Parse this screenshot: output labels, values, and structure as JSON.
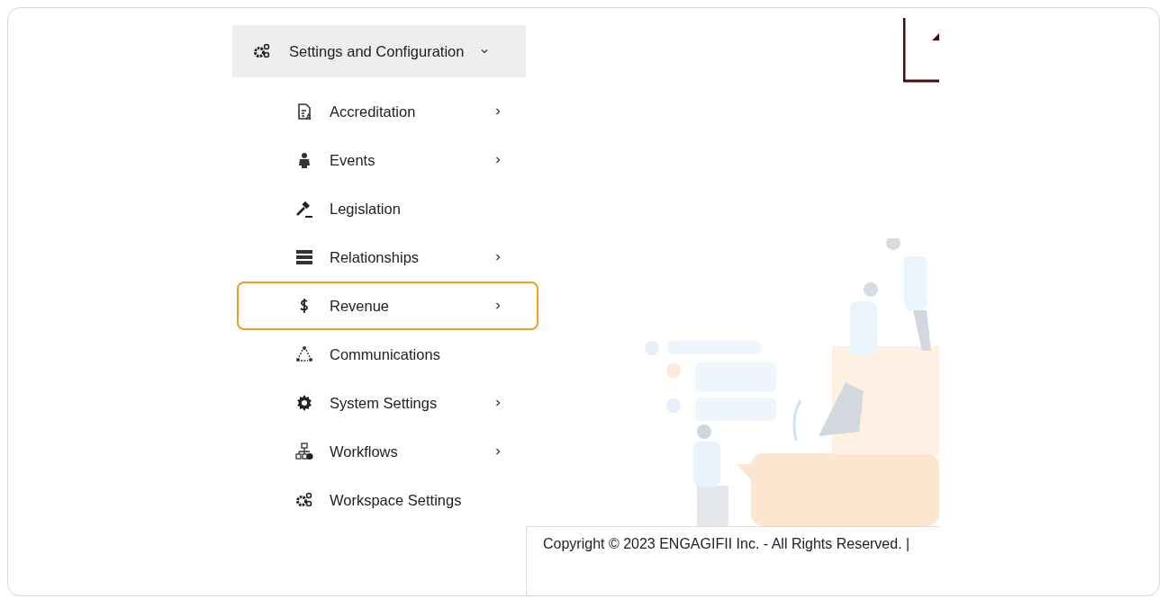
{
  "menu": {
    "title": "Settings and Configuration",
    "expanded": true
  },
  "items": [
    {
      "label": "Accreditation",
      "has_submenu": true,
      "highlighted": false
    },
    {
      "label": "Events",
      "has_submenu": true,
      "highlighted": false
    },
    {
      "label": "Legislation",
      "has_submenu": false,
      "highlighted": false
    },
    {
      "label": "Relationships",
      "has_submenu": true,
      "highlighted": false
    },
    {
      "label": "Revenue",
      "has_submenu": true,
      "highlighted": true
    },
    {
      "label": "Communications",
      "has_submenu": false,
      "highlighted": false
    },
    {
      "label": "System Settings",
      "has_submenu": true,
      "highlighted": false
    },
    {
      "label": "Workflows",
      "has_submenu": true,
      "highlighted": false
    },
    {
      "label": "Workspace Settings",
      "has_submenu": false,
      "highlighted": false
    }
  ],
  "footer": {
    "copyright": "Copyright © 2023 ENGAGIFII Inc. - All Rights Reserved. |"
  }
}
